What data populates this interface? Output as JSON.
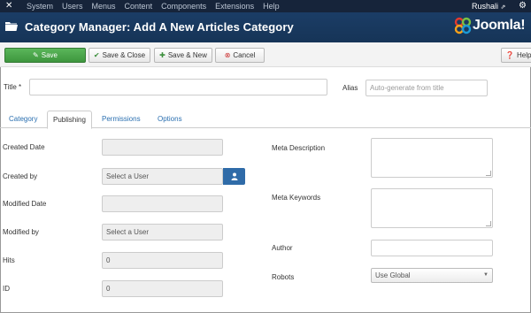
{
  "topnav": {
    "logo_icon": "joomla-icon",
    "menu": [
      "System",
      "Users",
      "Menus",
      "Content",
      "Components",
      "Extensions",
      "Help"
    ],
    "user": "Rushali",
    "external_icon": "external-link-icon",
    "settings_icon": "gear-icon"
  },
  "header": {
    "title": "Category Manager: Add A New Articles Category",
    "brand": "Joomla!",
    "brand_colors": [
      "#e33a2e",
      "#f7a11a",
      "#7ac143",
      "#1c9ad6"
    ]
  },
  "toolbar": {
    "save": "Save",
    "save_close": "Save & Close",
    "save_new": "Save & New",
    "cancel": "Cancel",
    "help": "Help"
  },
  "form": {
    "title_label": "Title *",
    "title_value": "",
    "alias_label": "Alias",
    "alias_placeholder": "Auto-generate from title"
  },
  "tabs": [
    "Category",
    "Publishing",
    "Permissions",
    "Options"
  ],
  "active_tab": "Publishing",
  "publishing": {
    "created_date_label": "Created Date",
    "created_by_label": "Created by",
    "created_by_value": "Select a User",
    "modified_date_label": "Modified Date",
    "modified_by_label": "Modified by",
    "modified_by_value": "Select a User",
    "hits_label": "Hits",
    "hits_value": "0",
    "id_label": "ID",
    "id_value": "0",
    "meta_description_label": "Meta Description",
    "meta_keywords_label": "Meta Keywords",
    "author_label": "Author",
    "robots_label": "Robots",
    "robots_value": "Use Global"
  },
  "colors": {
    "nav_bg": "#16243a",
    "header_bg": "#1b3d66",
    "save_green": "#4ca84c",
    "link_blue": "#2a6fb0",
    "user_button": "#2f6ba8"
  }
}
